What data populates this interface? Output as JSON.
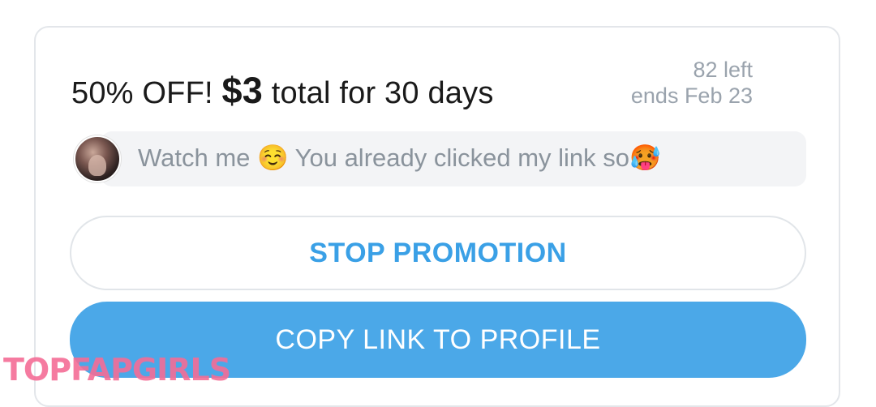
{
  "offer": {
    "discount": "50% OFF!",
    "price": "$3",
    "duration": "total for 30 days",
    "remaining": "82 left",
    "ends": "ends Feb 23"
  },
  "message": {
    "text": "Watch me ☺️ You already clicked my link so🥵"
  },
  "buttons": {
    "stop_promotion": "STOP PROMOTION",
    "copy_link": "COPY LINK TO PROFILE"
  },
  "watermark": "TOPFAPGIRLS",
  "colors": {
    "accent": "#4ba8e8",
    "stop_text": "#3aa0e6",
    "muted_text": "#9aa3ad",
    "watermark": "#f46d96"
  }
}
